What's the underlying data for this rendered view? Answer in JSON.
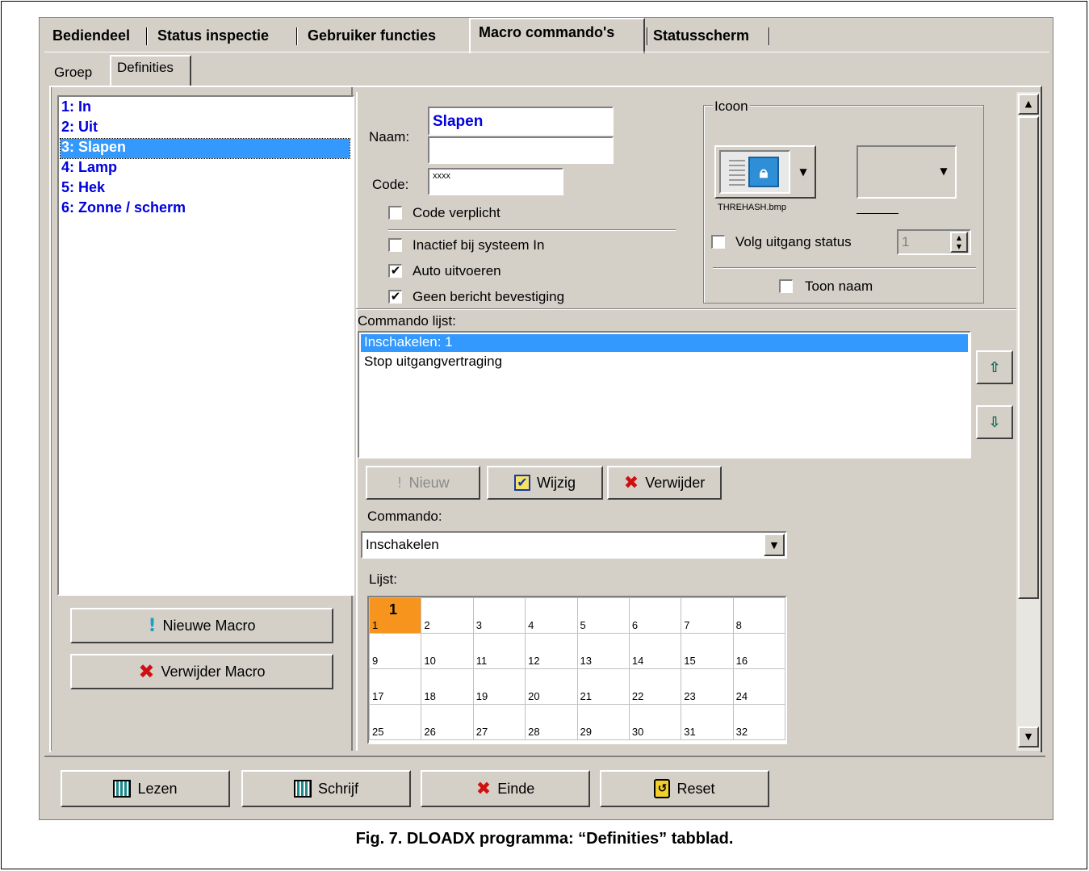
{
  "main_tabs": [
    "Bediendeel",
    "Status inspectie",
    "Gebruiker functies",
    "Macro commando's",
    "Statusscherm"
  ],
  "sub_tabs": [
    "Groep",
    "Definities"
  ],
  "macros": [
    "1: In",
    "2: Uit",
    "3: Slapen",
    "4: Lamp",
    "5: Hek",
    "6: Zonne / scherm"
  ],
  "selected_macro_index": 2,
  "left_buttons": {
    "new_macro": "Nieuwe Macro",
    "delete_macro": "Verwijder Macro"
  },
  "form": {
    "name_label": "Naam:",
    "name_value": "Slapen",
    "name_value2": "",
    "code_label": "Code:",
    "code_value": "xxxx",
    "code_required": "Code verplicht",
    "inactive": "Inactief bij systeem In",
    "auto_exec": "Auto uitvoeren",
    "no_confirm": "Geen bericht bevestiging",
    "checks": {
      "code_required": false,
      "inactive": false,
      "auto_exec": true,
      "no_confirm": true
    }
  },
  "icon_group": {
    "title": "Icoon",
    "filename": "THREHASH.bmp",
    "follow_output": "Volg uitgang status",
    "follow_output_value": "1",
    "show_name": "Toon naam"
  },
  "commands": {
    "label": "Commando lijst:",
    "items": [
      "Inschakelen: 1",
      "Stop uitgangvertraging"
    ],
    "selected_index": 0,
    "new": "Nieuw",
    "edit": "Wijzig",
    "delete": "Verwijder",
    "command_label": "Commando:",
    "command_value": "Inschakelen",
    "list_label": "Lijst:"
  },
  "grid": {
    "rows": [
      [
        "1",
        "2",
        "3",
        "4",
        "5",
        "6",
        "7",
        "8"
      ],
      [
        "9",
        "10",
        "11",
        "12",
        "13",
        "14",
        "15",
        "16"
      ],
      [
        "17",
        "18",
        "19",
        "20",
        "21",
        "22",
        "23",
        "24"
      ],
      [
        "25",
        "26",
        "27",
        "28",
        "29",
        "30",
        "31",
        "32"
      ]
    ],
    "selected_cell": "1",
    "selected_big": "1",
    "selected_color": "#f7941d"
  },
  "bottom_buttons": {
    "read": "Lezen",
    "write": "Schrijf",
    "end": "Einde",
    "reset": "Reset"
  },
  "caption": "Fig. 7. DLOADX programma: “Definities” tabblad.",
  "colors": {
    "window": "#d4d0c8",
    "selection": "#3399ff",
    "macro_text": "#0000e0",
    "delete_red": "#d01010"
  }
}
